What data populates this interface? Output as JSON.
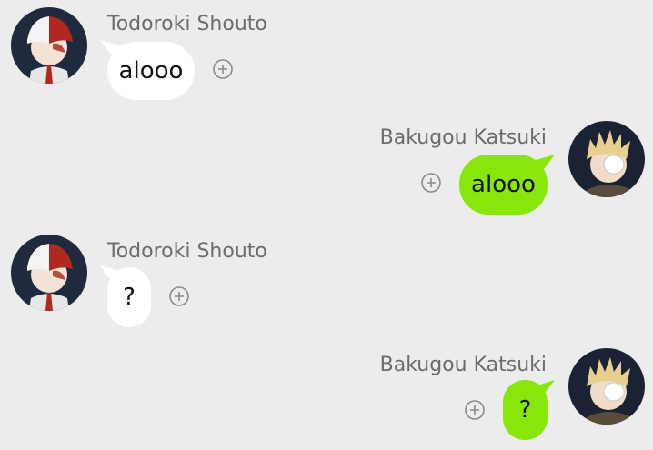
{
  "messages": [
    {
      "sender": "Todoroki Shouto",
      "text": "alooo",
      "side": "left",
      "avatar_icon": "todoroki-avatar",
      "action_icon": "plus-circle-icon"
    },
    {
      "sender": "Bakugou Katsuki",
      "text": "alooo",
      "side": "right",
      "avatar_icon": "bakugou-avatar",
      "action_icon": "plus-circle-icon"
    },
    {
      "sender": "Todoroki Shouto",
      "text": "?",
      "side": "left",
      "avatar_icon": "todoroki-avatar",
      "action_icon": "plus-circle-icon"
    },
    {
      "sender": "Bakugou Katsuki",
      "text": "?",
      "side": "right",
      "avatar_icon": "bakugou-avatar",
      "action_icon": "plus-circle-icon"
    }
  ],
  "colors": {
    "background": "#ececec",
    "left_bubble": "#ffffff",
    "right_bubble": "#88e60b",
    "name_text": "#6c6c6c",
    "plus_icon": "#8a8a8a"
  }
}
